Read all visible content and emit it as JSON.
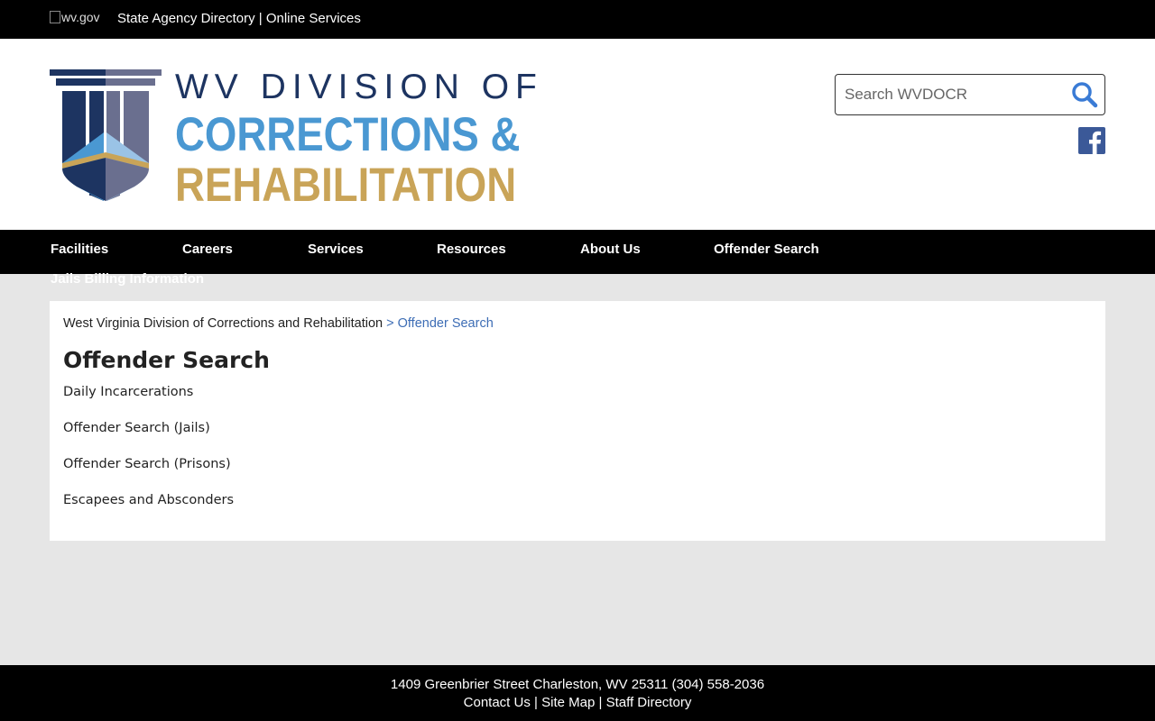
{
  "topbar": {
    "wvgov_alt": "wv.gov",
    "agency_directory": "State Agency Directory",
    "separator": "|",
    "online_services": "Online Services"
  },
  "logo": {
    "line1": "WV DIVISION OF",
    "line2": "CORRECTIONS &",
    "line3": "REHABILITATION",
    "colors": {
      "navy": "#1d3461",
      "blue": "#4a98d2",
      "gold": "#c9a458",
      "slate": "#6a6f8f"
    }
  },
  "search": {
    "placeholder": "Search WVDOCR",
    "icon": "search-icon"
  },
  "social": {
    "icon": "facebook-icon",
    "color": "#3b5998"
  },
  "nav": {
    "items": [
      "Facilities",
      "Careers",
      "Services",
      "Resources",
      "About Us",
      "Offender Search"
    ],
    "overflow_item": "Jails Billing Information"
  },
  "breadcrumb": {
    "root": "West Virginia Division of Corrections and Rehabilitation",
    "separator": ">",
    "current": "Offender Search"
  },
  "page": {
    "title": "Offender Search",
    "links": [
      "Daily Incarcerations",
      "Offender Search (Jails)",
      "Offender Search (Prisons)",
      "Escapees and Absconders"
    ]
  },
  "footer": {
    "address": "1409 Greenbrier Street Charleston, WV 25311 (304) 558-2036",
    "contact": "Contact Us",
    "sitemap": "Site Map",
    "staff": "Staff Directory",
    "separator": "|"
  }
}
